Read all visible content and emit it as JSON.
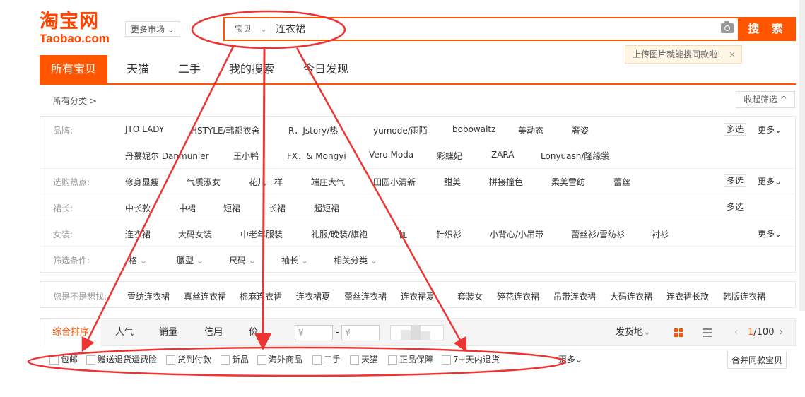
{
  "logo": {
    "cn": "淘宝网",
    "en": "Taobao.com"
  },
  "header": {
    "market_label": "更多市场",
    "search_type": "宝贝",
    "search_value": "连衣裙",
    "search_button": "搜 索",
    "tip": "上传图片就能搜同款啦!",
    "tip_close": "×"
  },
  "tabs": [
    "所有宝贝",
    "天猫",
    "二手",
    "我的搜索",
    "今日发现"
  ],
  "filters": {
    "crumb": "所有分类 >",
    "collapse": "收起筛选 ^",
    "multi": "多选",
    "more": "更多",
    "brand_label": "品牌:",
    "brands_row1": [
      "JTO LADY",
      "HSTYLE/韩都衣舍",
      "R．Jstory/热",
      "yumode/雨陌",
      "bobowaltz",
      "美动态",
      "奢姿"
    ],
    "brands_row2": [
      "丹慕妮尔 Danmunier",
      "王小鸭",
      "FX．& Mongyi",
      "Vero Moda",
      "彩蝶妃",
      "ZARA",
      "Lonyuash/隆缘裳"
    ],
    "hot_label": "选购热点:",
    "hot": [
      "修身显瘦",
      "气质淑女",
      "花儿一样",
      "端庄大气",
      "田园小清新",
      "甜美",
      "拼接撞色",
      "柔美雪纺",
      "蕾丝"
    ],
    "length_label": "裙长:",
    "length": [
      "中长款",
      "中裙",
      "短裙",
      "长裙",
      "超短裙"
    ],
    "women_label": "女装:",
    "women": [
      "连衣裙",
      "大码女装",
      "中老年服装",
      "礼服/晚装/旗袍",
      "恤",
      "针织衫",
      "小背心/小吊带",
      "蕾丝衫/雪纺衫",
      "衬衫"
    ],
    "cond_label": "筛选条件:",
    "cond": [
      "格",
      "腰型",
      "尺码",
      "袖长",
      "相关分类"
    ]
  },
  "guess": {
    "label": "您是不是想找:",
    "items": [
      "雪纺连衣裙",
      "真丝连衣裙",
      "棉麻连衣裙",
      "连衣裙夏",
      "蕾丝连衣裙",
      "连衣裙夏",
      "套装女",
      "碎花连衣裙",
      "吊带连衣裙",
      "大码连衣裙",
      "连衣裙长款",
      "韩版连衣裙"
    ]
  },
  "sort": {
    "items": [
      "综合排序",
      "人气",
      "销量",
      "信用",
      "价"
    ],
    "price_from": "¥",
    "price_to": "¥",
    "dash": "-",
    "ship": "发货地",
    "page_current": "1",
    "page_total": "/100"
  },
  "checks": {
    "items": [
      "包邮",
      "赠送退货运费险",
      "货到付款",
      "新品",
      "海外商品",
      "二手",
      "天猫",
      "正品保障",
      "7+天内退货"
    ],
    "more": "更多",
    "merge": "合并同款宝贝"
  },
  "colors": {
    "accent": "#ff5500",
    "annotation": "#ee3333"
  }
}
